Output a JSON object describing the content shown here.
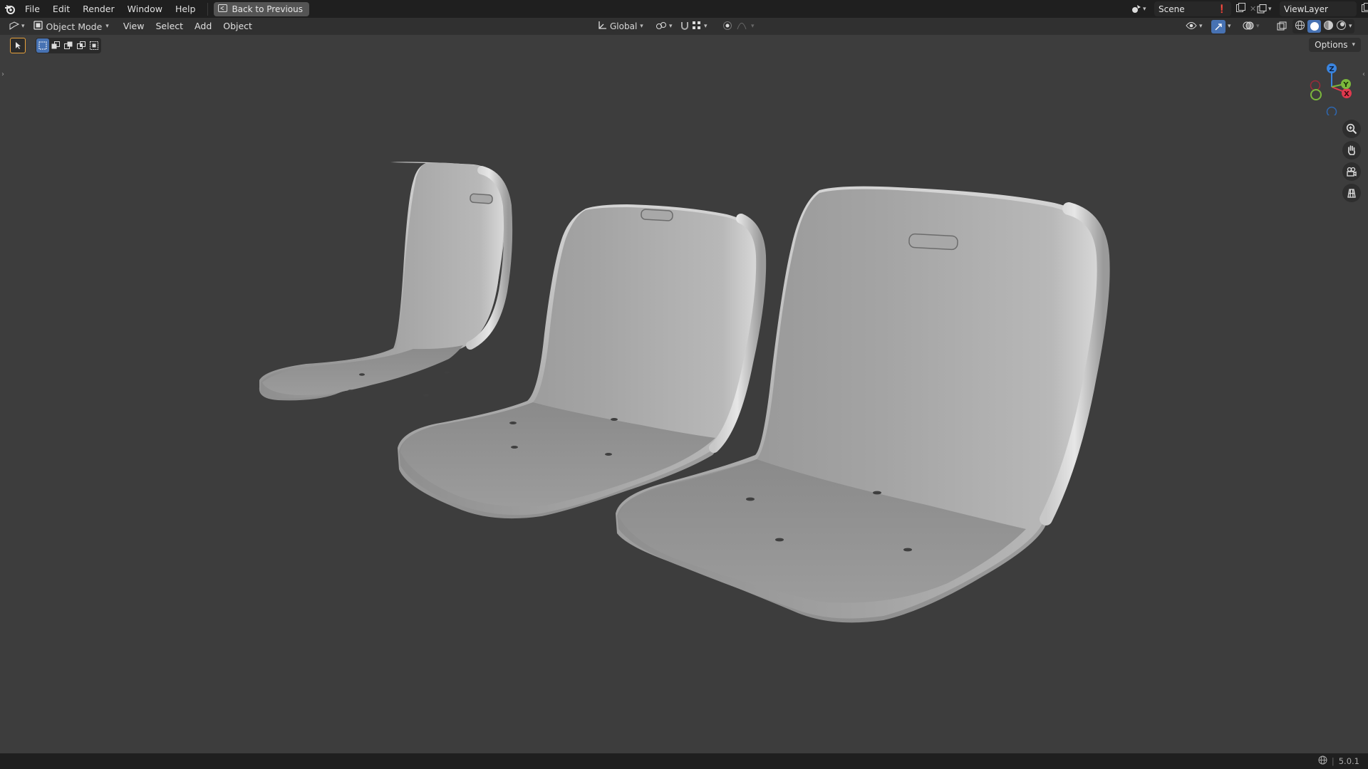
{
  "topbar": {
    "menus": [
      "File",
      "Edit",
      "Render",
      "Window",
      "Help"
    ],
    "back_label": "Back to Previous",
    "scene_label": "Scene",
    "viewlayer_label": "ViewLayer"
  },
  "header": {
    "editor_icon": "viewport-editor-icon",
    "mode_label": "Object Mode",
    "menus": [
      "View",
      "Select",
      "Add",
      "Object"
    ],
    "transform_orientation": "Global"
  },
  "viewport": {
    "options_label": "Options",
    "gizmo_axes": [
      "X",
      "Y",
      "Z"
    ],
    "nav_icons": [
      "zoom-icon",
      "pan-hand-icon",
      "camera-icon",
      "grid-icon"
    ],
    "colors": {
      "background": "#3d3d3d",
      "x_axis": "#e0394e",
      "y_axis": "#7bb83c",
      "z_axis": "#3a85e0"
    }
  },
  "status": {
    "version": "5.0.1"
  }
}
